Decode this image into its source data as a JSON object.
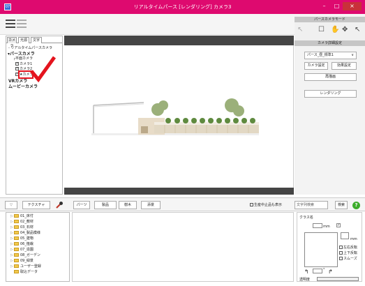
{
  "window": {
    "title": "リアルタイムパース [レンダリング] カメラ3",
    "app_icon": "07",
    "minimize": "–",
    "maximize": "□",
    "close": "×"
  },
  "mode_panel": {
    "title": "パースカメラモード",
    "tools": [
      "pointer-icon",
      "hand-icon",
      "move-icon",
      "camera-pointer-icon"
    ]
  },
  "left_panel": {
    "tabs": [
      "カメラ",
      "光源",
      "文字"
    ],
    "tree": {
      "realtime_camera": "リアルタイムパースカメラ",
      "perspective_camera": "パースカメラ",
      "plan_camera": "平面カメラ",
      "camera1": "カメラ1",
      "camera2": "カメラ2",
      "camera3": "カメラ3",
      "vr_camera": "VRカメラ",
      "movie_camera": "ムービーカメラ"
    }
  },
  "settings_panel": {
    "title": "カメラ詳細設定",
    "preset": "パース_昼_標準1",
    "camera_settings": "カメラ設定",
    "effect_settings": "効果設定",
    "redraw": "再描画",
    "render": "レンダリング"
  },
  "bottom_toolbar": {
    "filter": "▽",
    "texture": "テクスチャ",
    "tabs": [
      "パーツ",
      "製品",
      "樹木",
      "添景"
    ],
    "discontinued_label": "生産中止品も表示",
    "search_placeholder": "文字列検索",
    "search": "検索",
    "help": "?"
  },
  "categories": [
    "01_床付",
    "02_敷材",
    "03_石材",
    "04_製品模様",
    "05_建物",
    "06_植栽",
    "07_造園",
    "08_ガーデン",
    "09_緑景",
    "ユーザー登録",
    "取込データ"
  ],
  "properties": {
    "class_name": "クラス名",
    "unit_mm_1": "mm",
    "unit_mm_2": "mm",
    "flip_lr": "左右反転",
    "flip_ud": "上下反転",
    "smooth": "スムーズ",
    "rotation_unit": "°",
    "transparency": "透明度"
  },
  "colors": {
    "titlebar": "#de0a6f",
    "highlight": "#e4141e",
    "help": "#3dad2c"
  }
}
